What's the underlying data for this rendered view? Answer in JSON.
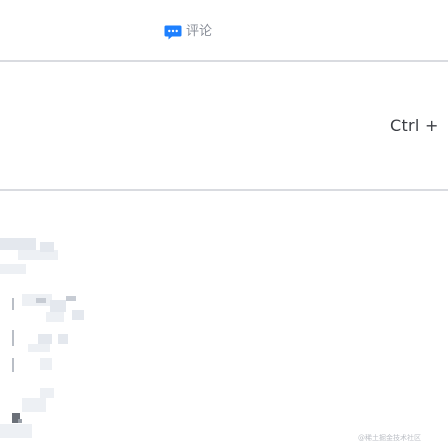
{
  "toolbar": {
    "comment_label": "评论",
    "comment_icon": "comment-bubble-icon",
    "accent_color": "#1e80ff"
  },
  "editor": {
    "shortcut_text": "Ctrl +"
  },
  "footer": {
    "watermark": "@稀土掘金技术社区"
  }
}
